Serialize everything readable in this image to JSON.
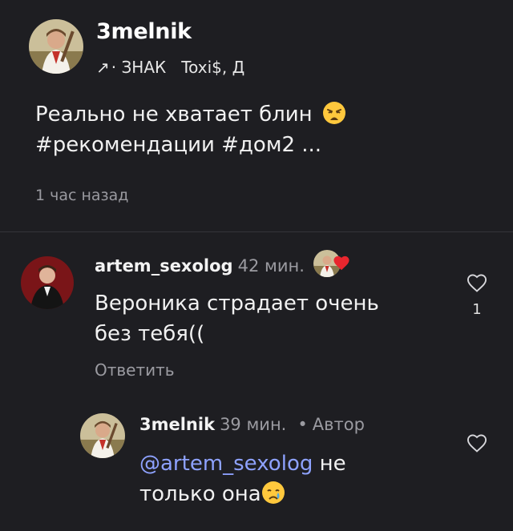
{
  "post": {
    "author": "3melnik",
    "meta_arrow": "↗",
    "meta_text": "· ЗНАК   Toxi$, Д",
    "text_line1": "Реально не хватает блин",
    "text_line2": "#рекомендации #дом2 ...",
    "emoji_weary": "weary-face-emoji",
    "time": "1 час назад"
  },
  "comments": [
    {
      "username": "artem_sexolog",
      "time": "42 мин.",
      "text_line1": "Вероника страдает очень",
      "text_line2": "без тебя((",
      "reply_label": "Ответить",
      "like_count": "1",
      "liked_by_author_icon": "author-avatar-heart"
    },
    {
      "username": "3melnik",
      "time": "39 мин.",
      "separator": "•",
      "author_tag": "Автор",
      "mention": "@artem_sexolog",
      "text_after_mention": " не",
      "text_line2": "только она",
      "emoji_crying": "crying-face-emoji"
    }
  ],
  "colors": {
    "background": "#1e1e22",
    "mention": "#8ea2ff",
    "muted": "#9b9ba1",
    "heart": "#e8262e"
  }
}
